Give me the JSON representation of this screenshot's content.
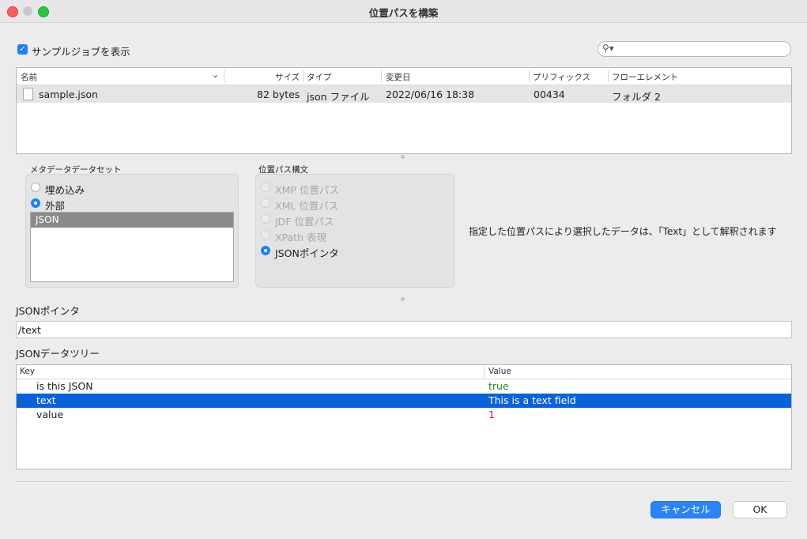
{
  "window": {
    "title": "位置パスを構築"
  },
  "show_samples": {
    "label": "サンプルジョブを表示",
    "checked": true
  },
  "search": {
    "value": ""
  },
  "file_table": {
    "columns": [
      "名前",
      "サイズ",
      "タイプ",
      "変更日",
      "プリフィックス",
      "フローエレメント"
    ],
    "rows": [
      {
        "name": "sample.json",
        "size": "82 bytes",
        "type": "json ファイル",
        "modified": "2022/06/16 18:38",
        "prefix": "00434",
        "flow": "フォルダ 2"
      }
    ]
  },
  "metadata_dataset": {
    "label": "メタデータデータセット",
    "options": [
      "埋め込み",
      "外部"
    ],
    "selected": "外部",
    "list": [
      "JSON"
    ]
  },
  "path_syntax": {
    "label": "位置パス構文",
    "options": [
      "XMP 位置パス",
      "XML 位置パス",
      "JDF 位置パス",
      "XPath 表現",
      "JSONポインタ"
    ],
    "selected": "JSONポインタ"
  },
  "note": "指定した位置パスにより選択したデータは、「Text」として解釈されます",
  "pointer": {
    "label": "JSONポインタ",
    "value": "/text"
  },
  "tree": {
    "label": "JSONデータツリー",
    "columns": [
      "Key",
      "Value"
    ],
    "rows": [
      {
        "key": "is this JSON",
        "value": "true"
      },
      {
        "key": "text",
        "value": "This is a text field"
      },
      {
        "key": "value",
        "value": "1"
      }
    ],
    "selected_index": 1
  },
  "buttons": {
    "cancel": "キャンセル",
    "ok": "OK"
  },
  "colors": {
    "accent": "#1a82fb",
    "selection": "#0862d9",
    "bool": "#1e8a1e",
    "number": "#e0201e"
  }
}
